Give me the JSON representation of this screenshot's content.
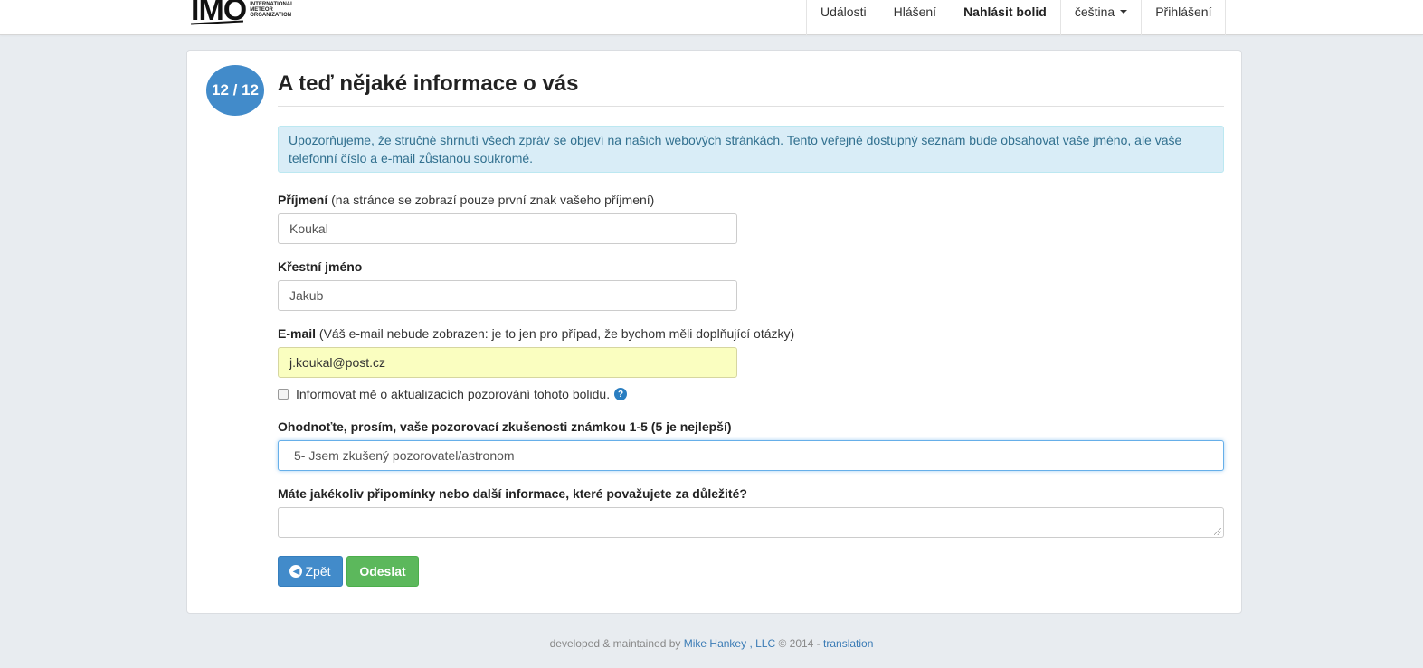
{
  "navbar": {
    "logo_text": "IMO",
    "logo_org_lines": [
      "International",
      "Meteor",
      "Organization"
    ],
    "items": [
      {
        "label": "Události"
      },
      {
        "label": "Hlášení"
      },
      {
        "label": "Nahlásit bolid",
        "active": true
      },
      {
        "label": "čeština",
        "dropdown": true
      },
      {
        "label": "Přihlášení"
      }
    ]
  },
  "step": {
    "badge": "12 / 12",
    "title": "A teď nějaké informace o vás"
  },
  "notice": "Upozorňujeme, že stručné shrnutí všech zpráv se objeví na našich webových stránkách. Tento veřejně dostupný seznam bude obsahovat vaše jméno, ale vaše telefonní číslo a e-mail zůstanou soukromé.",
  "form": {
    "surname": {
      "label": "Příjmení",
      "hint": "(na stránce se zobrazí pouze první znak vašeho příjmení)",
      "value": "Koukal"
    },
    "firstname": {
      "label": "Křestní jméno",
      "value": "Jakub"
    },
    "email": {
      "label": "E-mail",
      "hint": "(Váš e-mail nebude zobrazen: je to jen pro případ, že bychom měli doplňující otázky)",
      "value": "j.koukal@post.cz"
    },
    "notify": {
      "label": "Informovat mě o aktualizacích pozorování tohoto bolidu.",
      "help_icon": "question-circle-icon"
    },
    "experience": {
      "label": "Ohodnoťte, prosím, vaše pozorovací zkušenosti známkou 1-5 (5 je nejlepší)",
      "selected": "5- Jsem zkušený pozorovatel/astronom"
    },
    "comments": {
      "label": "Máte jakékoliv připomínky nebo další informace, které považujete za důležité?",
      "value": ""
    }
  },
  "buttons": {
    "back": "Zpět",
    "submit": "Odeslat"
  },
  "footer": {
    "prefix": "developed & maintained by",
    "author": "Mike Hankey",
    "company": ", LLC",
    "copyright": "© 2014 -",
    "translation": "translation"
  },
  "colors": {
    "primary": "#428bca",
    "success": "#5cb85c",
    "info_bg": "#d9edf7",
    "info_text": "#31708f"
  }
}
